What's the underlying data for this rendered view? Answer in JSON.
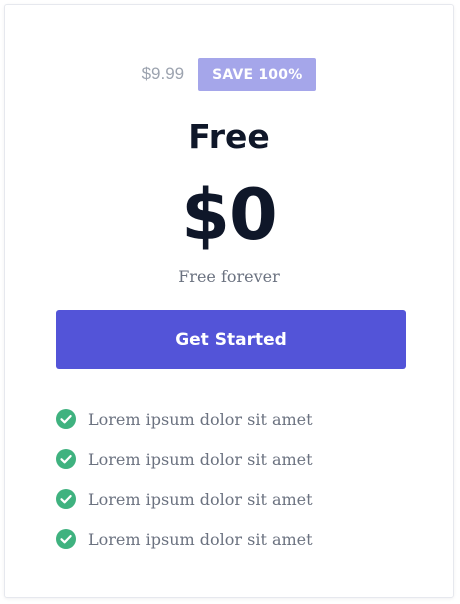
{
  "pricing_card": {
    "old_price": "$9.99",
    "save_badge": "SAVE 100%",
    "plan_name": "Free",
    "price": "$0",
    "subtitle": "Free forever",
    "cta_label": "Get Started",
    "features": [
      {
        "text": "Lorem ipsum dolor sit amet",
        "icon": "check-circle-icon"
      },
      {
        "text": "Lorem ipsum dolor sit amet",
        "icon": "check-circle-icon"
      },
      {
        "text": "Lorem ipsum dolor sit amet",
        "icon": "check-circle-icon"
      },
      {
        "text": "Lorem ipsum dolor sit amet",
        "icon": "check-circle-icon"
      }
    ]
  },
  "colors": {
    "accent": "#5354d8",
    "badge": "#a5a6ea",
    "check": "#3fb27f",
    "heading": "#0f1729",
    "muted": "#6b7280"
  }
}
